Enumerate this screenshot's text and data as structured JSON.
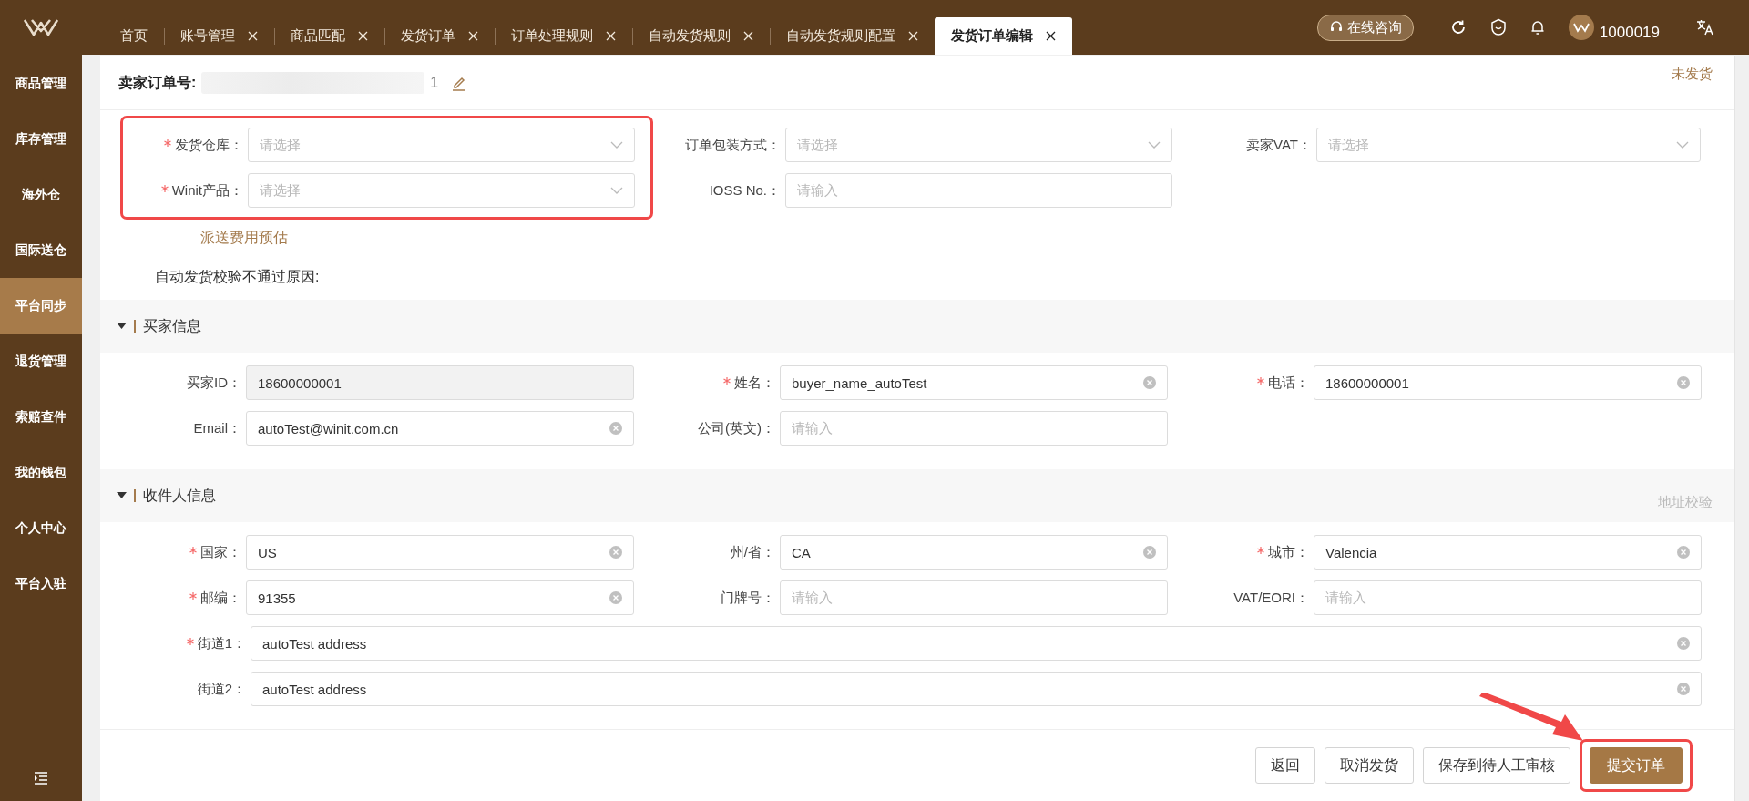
{
  "tabs": [
    {
      "label": "首页",
      "closable": false,
      "selected": false
    },
    {
      "label": "账号管理",
      "closable": true,
      "selected": false
    },
    {
      "label": "商品匹配",
      "closable": true,
      "selected": false
    },
    {
      "label": "发货订单",
      "closable": true,
      "selected": false
    },
    {
      "label": "订单处理规则",
      "closable": true,
      "selected": false
    },
    {
      "label": "自动发货规则",
      "closable": true,
      "selected": false
    },
    {
      "label": "自动发货规则配置",
      "closable": true,
      "selected": false
    },
    {
      "label": "发货订单编辑",
      "closable": true,
      "selected": true
    }
  ],
  "topbar": {
    "consult": "在线咨询",
    "user": "1000019"
  },
  "sidebar": {
    "items": [
      {
        "label": "商品管理",
        "selected": false
      },
      {
        "label": "库存管理",
        "selected": false
      },
      {
        "label": "海外仓",
        "selected": false
      },
      {
        "label": "国际送仓",
        "selected": false
      },
      {
        "label": "平台同步",
        "selected": true
      },
      {
        "label": "退货管理",
        "selected": false
      },
      {
        "label": "索赔查件",
        "selected": false
      },
      {
        "label": "我的钱包",
        "selected": false
      },
      {
        "label": "个人中心",
        "selected": false
      },
      {
        "label": "平台入驻",
        "selected": false
      }
    ]
  },
  "order": {
    "label": "卖家订单号:",
    "value": "1",
    "status": "未发货"
  },
  "order_columns": [
    {
      "highlighted": true,
      "fields": [
        {
          "label": "发货仓库：",
          "required": true,
          "kind": "select",
          "placeholder": "请选择"
        },
        {
          "label": "Winit产品：",
          "required": true,
          "kind": "select",
          "placeholder": "请选择"
        }
      ],
      "link": "派送费用预估"
    },
    {
      "fields": [
        {
          "label": "订单包装方式：",
          "required": false,
          "kind": "select",
          "placeholder": "请选择"
        },
        {
          "label": "IOSS No.：",
          "required": false,
          "kind": "input",
          "placeholder": "请输入"
        }
      ]
    },
    {
      "fields": [
        {
          "label": "卖家VAT：",
          "required": false,
          "kind": "select",
          "placeholder": "请选择"
        }
      ]
    }
  ],
  "reason_label": "自动发货校验不通过原因:",
  "sections": [
    {
      "title": "买家信息",
      "expanded": true,
      "fields": [
        {
          "label": "买家ID：",
          "required": false,
          "kind": "input",
          "value": "18600000001",
          "disabled": true
        },
        {
          "label": "姓名：",
          "required": true,
          "kind": "input",
          "value": "buyer_name_autoTest",
          "disabled": false
        },
        {
          "label": "电话：",
          "required": true,
          "kind": "input",
          "value": "18600000001",
          "disabled": false
        },
        {
          "label": "Email：",
          "required": false,
          "kind": "input",
          "value": "autoTest@winit.com.cn",
          "disabled": false
        },
        {
          "label": "公司(英文)：",
          "required": false,
          "kind": "input",
          "placeholder": "请输入",
          "disabled": false
        }
      ]
    },
    {
      "title": "收件人信息",
      "expanded": true,
      "action": "地址校验",
      "fields": [
        {
          "label": "国家：",
          "required": true,
          "kind": "input",
          "value": "US",
          "disabled": false
        },
        {
          "label": "州/省：",
          "required": false,
          "kind": "input",
          "value": "CA",
          "disabled": false
        },
        {
          "label": "城市：",
          "required": true,
          "kind": "input",
          "value": "Valencia",
          "disabled": false
        },
        {
          "label": "邮编：",
          "required": true,
          "kind": "input",
          "value": "91355",
          "disabled": false
        },
        {
          "label": "门牌号：",
          "required": false,
          "kind": "input",
          "placeholder": "请输入",
          "disabled": false
        },
        {
          "label": "VAT/EORI：",
          "required": false,
          "kind": "input",
          "placeholder": "请输入",
          "disabled": false
        },
        {
          "label": "街道1：",
          "required": true,
          "kind": "wide",
          "value": "autoTest address",
          "disabled": false
        },
        {
          "label": "街道2：",
          "required": false,
          "kind": "wide",
          "value": "autoTest address",
          "disabled": false
        }
      ]
    }
  ],
  "buttons": [
    {
      "label": "返回",
      "primary": false
    },
    {
      "label": "取消发货",
      "primary": false
    },
    {
      "label": "保存到待人工审核",
      "primary": false
    },
    {
      "label": "提交订单",
      "primary": true,
      "highlighted": true
    }
  ]
}
